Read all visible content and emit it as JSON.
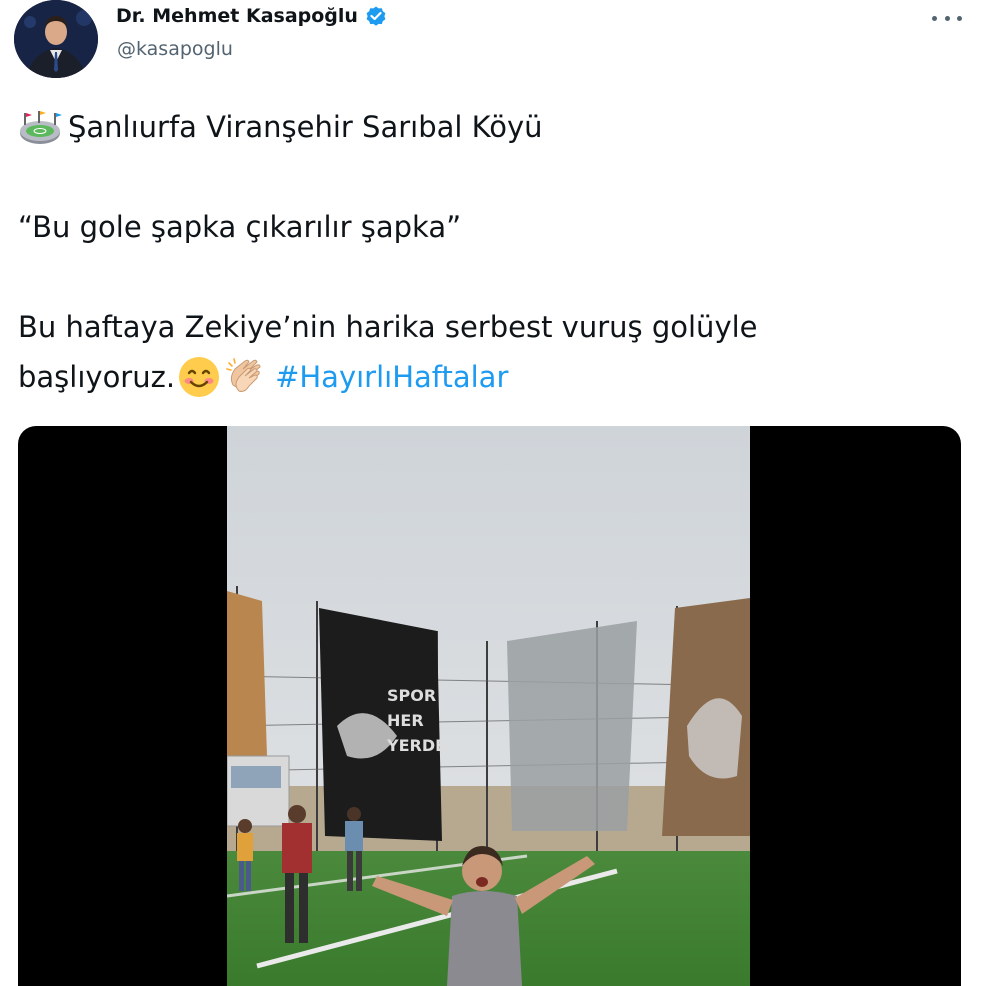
{
  "author": {
    "display_name": "Dr. Mehmet Kasapoğlu",
    "handle": "@kasapoglu",
    "avatar_icon": "profile-photo",
    "verified_icon": "verified-badge-icon"
  },
  "more_menu_icon": "more-dots-icon",
  "tweet": {
    "line1": "Şanlıurfa Viranşehir Sarıbal Köyü",
    "line1_icon": "stadium-emoji",
    "line2": "“Bu gole şapka çıkarılır şapka”",
    "line3": "Bu haftaya Zekiye’nin harika serbest vuruş golüyle",
    "line4": "başlıyoruz.",
    "line4_emojis": [
      "smiling-face-emoji",
      "clapping-hands-emoji"
    ],
    "hashtag": "#HayırlıHaftalar"
  },
  "media": {
    "type": "video",
    "description_icon": "video-thumbnail"
  },
  "colors": {
    "accent": "#1d9bf0",
    "text": "#0f1419",
    "muted": "#536471",
    "media_bg": "#000000"
  }
}
